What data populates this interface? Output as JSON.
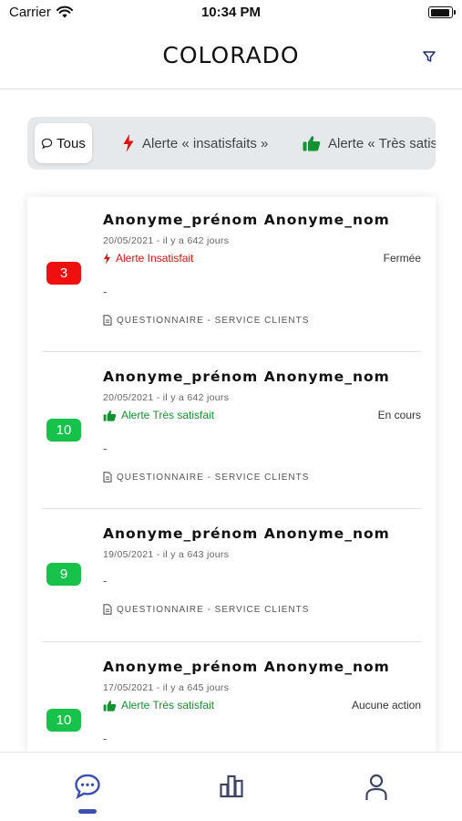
{
  "status_bar": {
    "carrier": "Carrier",
    "time": "10:34 PM",
    "battery_level": 0.95
  },
  "header": {
    "title": "COLORADO"
  },
  "filters": {
    "all": "Tous",
    "alert_unsatisfied": "Alerte « insatisfaits »",
    "alert_very_satisfied": "Alerte « Très satisfaits »"
  },
  "responses": [
    {
      "score": "3",
      "score_color": "#ef0f0f",
      "name": "Anonyme_prénom Anonyme_nom",
      "date": "20/05/2021 - il y a 642 jours",
      "alert": "Alerte Insatisfait",
      "alert_type": "bad",
      "status": "Fermée",
      "comment": "-",
      "questionnaire": "QUESTIONNAIRE - SERVICE CLIENTS"
    },
    {
      "score": "10",
      "score_color": "#16c24a",
      "name": "Anonyme_prénom Anonyme_nom",
      "date": "20/05/2021 - il y a 642 jours",
      "alert": "Alerte Très satisfait",
      "alert_type": "good",
      "status": "En cours",
      "comment": "-",
      "questionnaire": "QUESTIONNAIRE - SERVICE CLIENTS"
    },
    {
      "score": "9",
      "score_color": "#16c24a",
      "name": "Anonyme_prénom Anonyme_nom",
      "date": "19/05/2021 - il y a 643 jours",
      "alert": "",
      "alert_type": "none",
      "status": "",
      "comment": "-",
      "questionnaire": "QUESTIONNAIRE - SERVICE CLIENTS"
    },
    {
      "score": "10",
      "score_color": "#16c24a",
      "name": "Anonyme_prénom Anonyme_nom",
      "date": "17/05/2021 - il y a 645 jours",
      "alert": "Alerte Très satisfait",
      "alert_type": "good",
      "status": "Aucune action",
      "comment": "-",
      "questionnaire": ""
    }
  ],
  "tabs": [
    {
      "icon": "chat-icon",
      "active": true
    },
    {
      "icon": "bar-chart-icon",
      "active": false
    },
    {
      "icon": "user-icon",
      "active": false
    }
  ],
  "colors": {
    "accent": "#3a4fb4",
    "alert_bad": "#e01010",
    "alert_good": "#13932f",
    "segment_bg": "#e6e9ec"
  }
}
